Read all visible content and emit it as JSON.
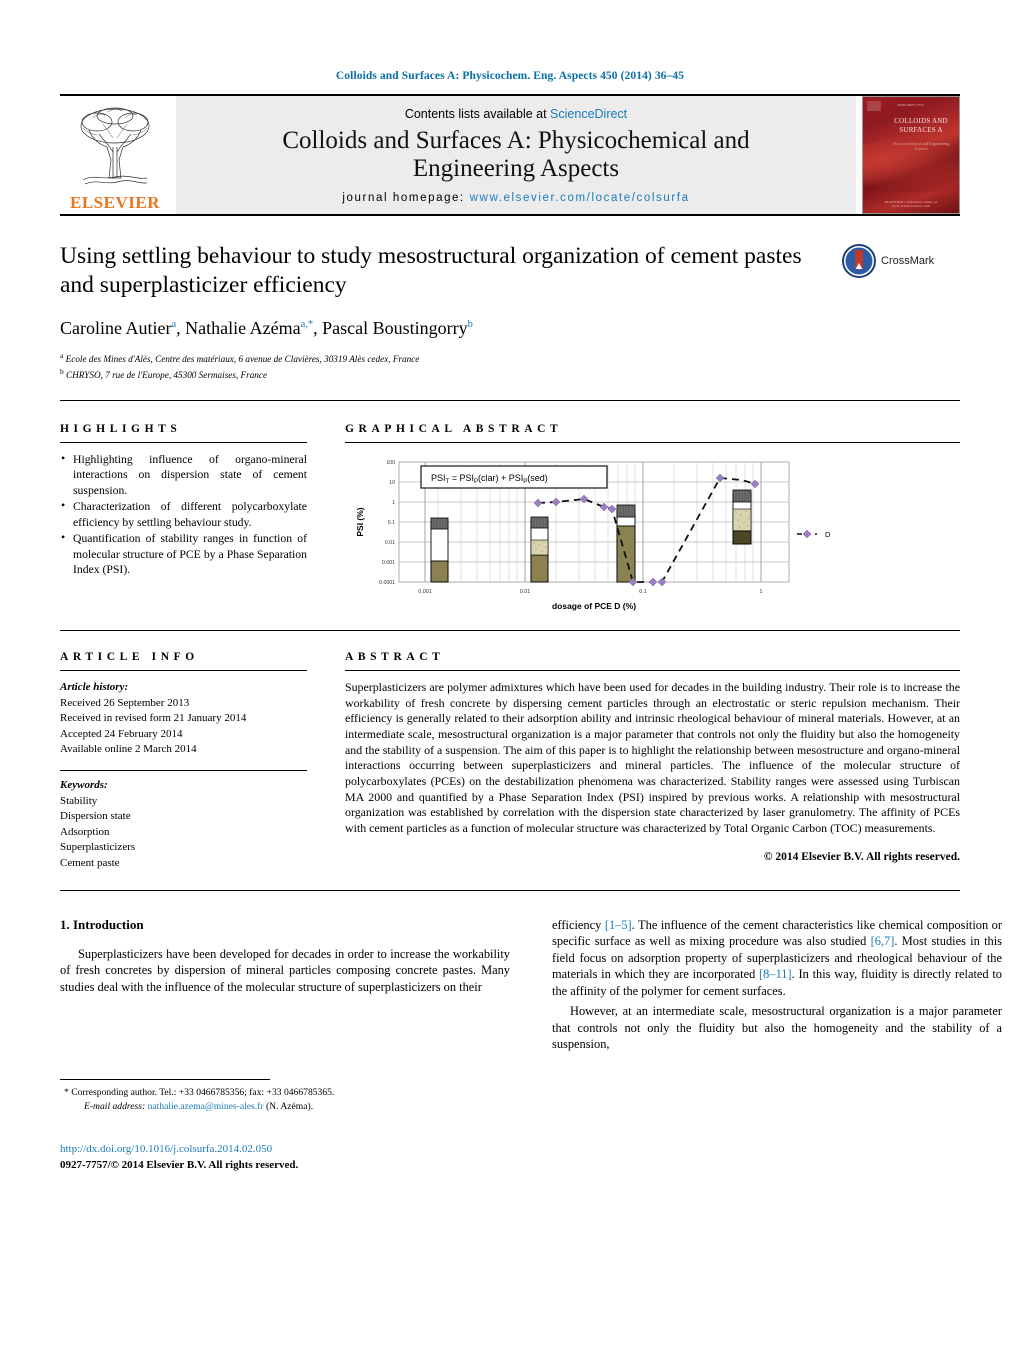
{
  "running_head": "Colloids and Surfaces A: Physicochem. Eng. Aspects 450 (2014) 36–45",
  "banner": {
    "publisher": "ELSEVIER",
    "contents_prefix": "Contents lists available at ",
    "contents_link": "ScienceDirect",
    "journal_title_line1": "Colloids and Surfaces A: Physicochemical and",
    "journal_title_line2": "Engineering Aspects",
    "homepage_label": "journal homepage:",
    "homepage_url": "www.elsevier.com/locate/colsurfa",
    "cover": {
      "top_meta": "ISSN 0927-7757",
      "title": "COLLOIDS AND SURFACES A",
      "subtitle": "Physicochemical and Engineering Aspects",
      "foot_meta": "ELSEVIER  •  available online at www.sciencedirect.com"
    }
  },
  "article": {
    "title": "Using settling behaviour to study mesostructural organization of cement pastes and superplasticizer efficiency",
    "authors": [
      {
        "name": "Caroline Autier",
        "sup": "a"
      },
      {
        "name": "Nathalie Azéma",
        "sup": "a,*"
      },
      {
        "name": "Pascal Boustingorry",
        "sup": "b"
      }
    ],
    "affiliations": [
      {
        "sup": "a",
        "text": "Ecole des Mines d'Alès, Centre des matériaux, 6 avenue de Clavières, 30319 Alès cedex, France"
      },
      {
        "sup": "b",
        "text": "CHRYSO, 7 rue de l'Europe, 45300 Sermaises, France"
      }
    ],
    "crossmark_label": "CrossMark"
  },
  "highlights": {
    "heading": "HIGHLIGHTS",
    "items": [
      "Highlighting influence of organo-mineral interactions on dispersion state of cement suspension.",
      "Characterization of different polycarboxylate efficiency by settling behaviour study.",
      "Quantification of stability ranges in function of molecular structure of PCE by a Phase Separation Index (PSI)."
    ]
  },
  "graphical_abstract": {
    "heading": "GRAPHICAL ABSTRACT"
  },
  "chart_data": {
    "type": "line",
    "title": "",
    "annotation": "PSIT = PSIP(clar) + PSIP(sed)",
    "xlabel": "dosage of PCE D (%)",
    "ylabel": "PSI (%)",
    "xscale": "log",
    "yscale": "log",
    "xlim": [
      0.001,
      3
    ],
    "ylim": [
      0.0001,
      100
    ],
    "xticks": [
      "0.001",
      "0.01",
      "0.1",
      "1"
    ],
    "yticks": [
      "100",
      "10",
      "1",
      "0.1",
      "0.01",
      "0.001",
      "0.0001"
    ],
    "legend": [
      "D"
    ],
    "series": [
      {
        "name": "D",
        "marker": "diamond",
        "color": "#9a7fbf",
        "x": [
          0.016,
          0.025,
          0.05,
          0.085,
          0.11,
          0.3,
          0.5,
          0.9,
          1.4
        ],
        "y": [
          1.0,
          1.1,
          1.3,
          0.72,
          0.62,
          0.0001,
          0.0001,
          23,
          10
        ]
      }
    ],
    "vials": [
      {
        "x": 0.001,
        "clear_top": 0.1,
        "sed_bottom": 0.0001,
        "label": "vial at 0.001%"
      },
      {
        "x": 0.05,
        "clear_top": 0.12,
        "sed_bottom": 0.0001,
        "label": "vial at 0.05%"
      },
      {
        "x": 0.3,
        "clear_top": 0.25,
        "sed_bottom": 0.0001,
        "label": "vial at 0.3%"
      },
      {
        "x": 1.0,
        "clear_top": 3.0,
        "sed_bottom": 0.008,
        "label": "vial at 1%"
      }
    ],
    "colors": {
      "sediment": "#8c8151",
      "clear": "#ffffff",
      "cap": "#555555",
      "marker": "#9a7fbf"
    }
  },
  "article_info": {
    "heading": "ARTICLE INFO",
    "history_label": "Article history:",
    "history": [
      "Received 26 September 2013",
      "Received in revised form 21 January 2014",
      "Accepted 24 February 2014",
      "Available online 2 March 2014"
    ],
    "keywords_label": "Keywords:",
    "keywords": [
      "Stability",
      "Dispersion state",
      "Adsorption",
      "Superplasticizers",
      "Cement paste"
    ]
  },
  "abstract": {
    "heading": "ABSTRACT",
    "text": "Superplasticizers are polymer admixtures which have been used for decades in the building industry. Their role is to increase the workability of fresh concrete by dispersing cement particles through an electrostatic or steric repulsion mechanism. Their efficiency is generally related to their adsorption ability and intrinsic rheological behaviour of mineral materials. However, at an intermediate scale, mesostructural organization is a major parameter that controls not only the fluidity but also the homogeneity and the stability of a suspension. The aim of this paper is to highlight the relationship between mesostructure and organo-mineral interactions occurring between superplasticizers and mineral particles. The influence of the molecular structure of polycarboxylates (PCEs) on the destabilization phenomena was characterized. Stability ranges were assessed using Turbiscan MA 2000 and quantified by a Phase Separation Index (PSI) inspired by previous works. A relationship with mesostructural organization was established by correlation with the dispersion state characterized by laser granulometry. The affinity of PCEs with cement particles as a function of molecular structure was characterized by Total Organic Carbon (TOC) measurements.",
    "copyright": "© 2014 Elsevier B.V. All rights reserved."
  },
  "introduction": {
    "number_title": "1.  Introduction",
    "left_paragraph": "Superplasticizers have been developed for decades in order to increase the workability of fresh concretes by dispersion of mineral particles composing concrete pastes. Many studies deal with the influence of the molecular structure of superplasticizers on their",
    "right_p1_a": "efficiency ",
    "right_p1_ref1": "[1–5]",
    "right_p1_b": ". The influence of the cement characteristics like chemical composition or specific surface as well as mixing procedure was also studied ",
    "right_p1_ref2": "[6,7]",
    "right_p1_c": ". Most studies in this field focus on adsorption property of superplasticizers and rheological behaviour of the materials in which they are incorporated ",
    "right_p1_ref3": "[8–11]",
    "right_p1_d": ". In this way, fluidity is directly related to the affinity of the polymer for cement surfaces.",
    "right_p2": "However, at an intermediate scale, mesostructural organization is a major parameter that controls not only the fluidity but also the homogeneity and the stability of a suspension,"
  },
  "footer": {
    "corresponding_marker": "*",
    "corresponding_text": "Corresponding author. Tel.: +33 0466785356; fax: +33 0466785365.",
    "email_label": "E-mail address:",
    "email": "nathalie.azema@mines-ales.fr",
    "email_suffix": "(N. Azéma).",
    "doi": "http://dx.doi.org/10.1016/j.colsurfa.2014.02.050",
    "issn_line": "0927-7757/© 2014 Elsevier B.V. All rights reserved."
  },
  "colors": {
    "link": "#1a7bb9",
    "running_head": "#0a6ea8",
    "elsevier_orange": "#E87722"
  }
}
